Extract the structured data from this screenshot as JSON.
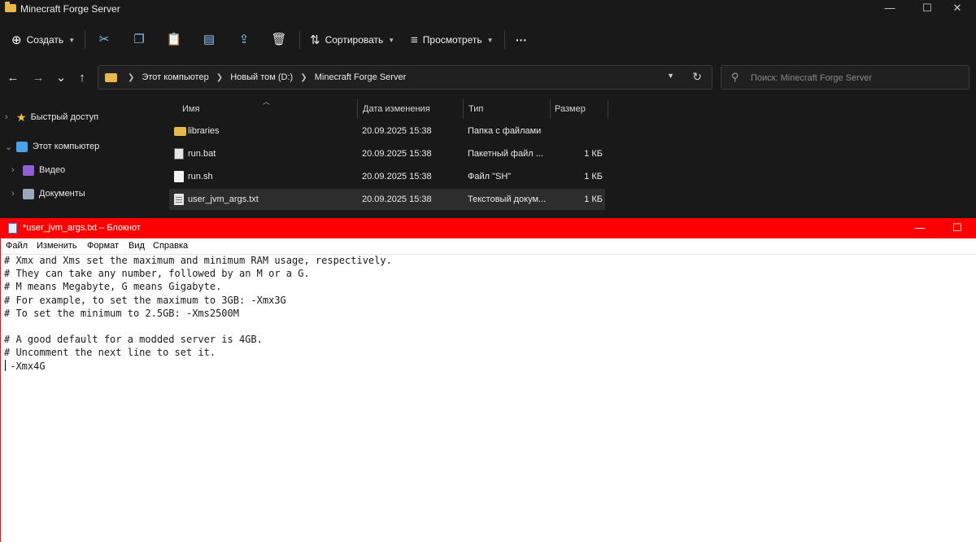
{
  "explorer": {
    "title": "Minecraft Forge Server",
    "window_controls": {
      "minimize": "—",
      "maximize": "☐",
      "close": "✕"
    },
    "toolbar": {
      "create": "Создать",
      "sort": "Сортировать",
      "view": "Просмотреть",
      "more": "···",
      "icons": [
        "cut-icon",
        "copy-icon",
        "paste-icon",
        "rename-icon",
        "share-icon",
        "delete-icon"
      ]
    },
    "nav": {
      "back": "←",
      "forward": "→",
      "recent": "⌄",
      "up": "↑"
    },
    "breadcrumb": [
      "Этот компьютер",
      "Новый том (D:)",
      "Minecraft Forge Server"
    ],
    "search_placeholder": "Поиск: Minecraft Forge Server",
    "sidebar": [
      {
        "label": "Быстрый доступ",
        "icon": "star-icon"
      },
      {
        "label": "Этот компьютер",
        "icon": "computer-icon"
      },
      {
        "label": "Видео",
        "icon": "video-icon"
      },
      {
        "label": "Документы",
        "icon": "documents-icon"
      }
    ],
    "columns": [
      "Имя",
      "Дата изменения",
      "Тип",
      "Размер"
    ],
    "files": [
      {
        "name": "libraries",
        "date": "20.09.2025 15:38",
        "type": "Папка с файлами",
        "size": "",
        "icon": "folder-icon"
      },
      {
        "name": "run.bat",
        "date": "20.09.2025 15:38",
        "type": "Пакетный файл ...",
        "size": "1 КБ",
        "icon": "bat-file-icon"
      },
      {
        "name": "run.sh",
        "date": "20.09.2025 15:38",
        "type": "Файл \"SH\"",
        "size": "1 КБ",
        "icon": "file-icon"
      },
      {
        "name": "user_jvm_args.txt",
        "date": "20.09.2025 15:38",
        "type": "Текстовый докум...",
        "size": "1 КБ",
        "icon": "text-file-icon"
      }
    ]
  },
  "notepad": {
    "title": "*user_jvm_args.txt – Блокнот",
    "window_controls": {
      "minimize": "—",
      "maximize": "☐"
    },
    "menu": [
      "Файл",
      "Изменить",
      "Формат",
      "Вид",
      "Справка"
    ],
    "content": "# Xmx and Xms set the maximum and minimum RAM usage, respectively.\n# They can take any number, followed by an M or a G.\n# M means Megabyte, G means Gigabyte.\n# For example, to set the maximum to 3GB: -Xmx3G\n# To set the minimum to 2.5GB: -Xms2500M\n\n# A good default for a modded server is 4GB.\n# Uncomment the next line to set it.\n -Xmx4G"
  }
}
